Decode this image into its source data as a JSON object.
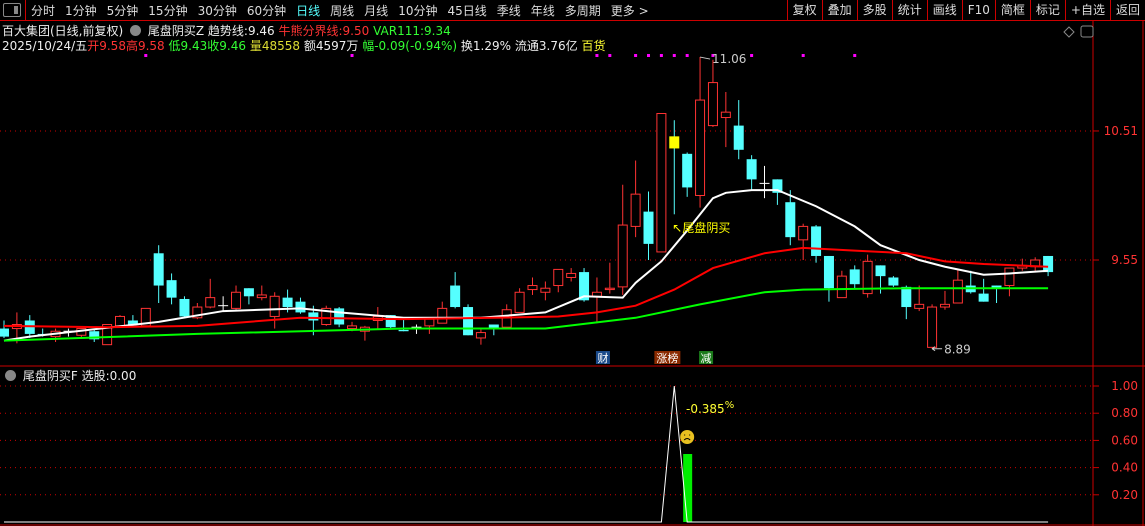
{
  "toolbar": {
    "tabs": [
      "分时",
      "1分钟",
      "5分钟",
      "15分钟",
      "30分钟",
      "60分钟",
      "日线",
      "周线",
      "月线",
      "10分钟",
      "45日线",
      "季线",
      "年线",
      "多周期",
      "更多 >"
    ],
    "active": "日线",
    "right_buttons": [
      "复权",
      "叠加",
      "多股",
      "统计",
      "画线",
      "F10",
      "简框",
      "标记",
      "+自选",
      "返回"
    ]
  },
  "header": {
    "title": "百大集团(日线,前复权)",
    "indicator": "尾盘阴买Z",
    "trend_label": "趋势线:",
    "trend_value": "9.46",
    "bull_label": "牛熊分界线:",
    "bull_value": "9.50",
    "var_label": "VAR111:",
    "var_value": "9.34"
  },
  "quote": {
    "date": "2025/10/24/五",
    "open_label": "开",
    "open": "9.58",
    "high_label": "高",
    "high": "9.58",
    "low_label": "低",
    "low": "9.43",
    "close_label": "收",
    "close": "9.46",
    "vol_label": "量",
    "vol": "48558",
    "amount": "额4597万",
    "change": "幅-0.09(-0.94%)",
    "turnover": "换1.29%",
    "float": "流通3.76亿",
    "sector": "百货"
  },
  "sub": {
    "indicator": "尾盘阴买F",
    "pick_label": "选股:",
    "pick_value": "0.00",
    "annotation": "-0.385",
    "annotation_unit": "%"
  },
  "colors": {
    "up": "#ff3333",
    "down": "#55ffff",
    "trend": "#ffffff",
    "bull_bear": "#ff0000",
    "var111": "#00ff00",
    "signal": "#ffff00",
    "dots": "#ff00ff",
    "axis": "#cc0000"
  },
  "chart_data": [
    {
      "type": "candlestick",
      "ylim": [
        8.78,
        11.17
      ],
      "y_ticks": [
        "10.51",
        "9.55"
      ],
      "y_tick_values": [
        10.51,
        9.55
      ],
      "candles_ohlc": [
        [
          9.04,
          9.1,
          8.97,
          8.98
        ],
        [
          9.04,
          9.16,
          8.93,
          9.07
        ],
        [
          9.1,
          9.14,
          8.97,
          9.0
        ],
        [
          9.0,
          9.04,
          8.98,
          8.99
        ],
        [
          8.98,
          9.04,
          8.94,
          9.02
        ],
        [
          9.02,
          9.04,
          8.98,
          9.02
        ],
        [
          8.99,
          9.04,
          8.97,
          9.04
        ],
        [
          9.02,
          9.04,
          8.94,
          8.96
        ],
        [
          8.92,
          9.07,
          8.92,
          9.07
        ],
        [
          9.06,
          9.14,
          9.05,
          9.13
        ],
        [
          9.1,
          9.14,
          9.06,
          9.07
        ],
        [
          9.06,
          9.19,
          9.06,
          9.19
        ],
        [
          9.6,
          9.66,
          9.23,
          9.36
        ],
        [
          9.4,
          9.45,
          9.22,
          9.27
        ],
        [
          9.26,
          9.28,
          9.12,
          9.13
        ],
        [
          9.12,
          9.23,
          9.11,
          9.2
        ],
        [
          9.2,
          9.41,
          9.19,
          9.27
        ],
        [
          9.21,
          9.28,
          9.17,
          9.21
        ],
        [
          9.19,
          9.36,
          9.18,
          9.31
        ],
        [
          9.34,
          9.34,
          9.22,
          9.28
        ],
        [
          9.27,
          9.36,
          9.25,
          9.29
        ],
        [
          9.13,
          9.31,
          9.04,
          9.28
        ],
        [
          9.27,
          9.33,
          9.16,
          9.2
        ],
        [
          9.24,
          9.27,
          9.15,
          9.16
        ],
        [
          9.16,
          9.21,
          8.99,
          9.1
        ],
        [
          9.07,
          9.21,
          9.06,
          9.19
        ],
        [
          9.19,
          9.2,
          9.05,
          9.07
        ],
        [
          9.04,
          9.09,
          9.02,
          9.06
        ],
        [
          9.02,
          9.06,
          8.95,
          9.05
        ],
        [
          9.1,
          9.2,
          9.04,
          9.13
        ],
        [
          9.14,
          9.14,
          9.04,
          9.05
        ],
        [
          9.03,
          9.11,
          9.02,
          9.02
        ],
        [
          9.05,
          9.07,
          9.0,
          9.05
        ],
        [
          9.06,
          9.11,
          9.0,
          9.11
        ],
        [
          9.08,
          9.24,
          9.08,
          9.19
        ],
        [
          9.36,
          9.46,
          9.19,
          9.2
        ],
        [
          9.2,
          9.22,
          8.99,
          8.99
        ],
        [
          8.97,
          9.04,
          8.92,
          9.01
        ],
        [
          9.07,
          9.07,
          8.99,
          9.04
        ],
        [
          9.05,
          9.22,
          9.05,
          9.18
        ],
        [
          9.16,
          9.34,
          9.16,
          9.31
        ],
        [
          9.33,
          9.42,
          9.29,
          9.36
        ],
        [
          9.31,
          9.39,
          9.25,
          9.34
        ],
        [
          9.36,
          9.48,
          9.31,
          9.48
        ],
        [
          9.42,
          9.49,
          9.39,
          9.45
        ],
        [
          9.46,
          9.49,
          9.24,
          9.25
        ],
        [
          9.28,
          9.42,
          9.08,
          9.31
        ],
        [
          9.33,
          9.53,
          9.3,
          9.34
        ],
        [
          9.35,
          10.11,
          9.29,
          9.81
        ],
        [
          9.8,
          10.29,
          9.72,
          10.04
        ],
        [
          9.91,
          10.06,
          9.55,
          9.67
        ],
        [
          9.61,
          10.64,
          9.61,
          10.64
        ],
        [
          10.47,
          10.59,
          9.89,
          10.38
        ],
        [
          10.34,
          10.35,
          10.02,
          10.09
        ],
        [
          10.03,
          11.06,
          9.94,
          10.74
        ],
        [
          10.55,
          11.04,
          10.54,
          10.87
        ],
        [
          10.61,
          10.8,
          10.39,
          10.65
        ],
        [
          10.55,
          10.74,
          10.3,
          10.37
        ],
        [
          10.3,
          10.33,
          10.07,
          10.15
        ],
        [
          10.12,
          10.25,
          10.01,
          10.12
        ],
        [
          10.15,
          10.15,
          9.96,
          10.05
        ],
        [
          9.98,
          10.07,
          9.66,
          9.72
        ],
        [
          9.7,
          9.82,
          9.55,
          9.8
        ],
        [
          9.8,
          9.81,
          9.53,
          9.58
        ],
        [
          9.58,
          9.58,
          9.24,
          9.34
        ],
        [
          9.27,
          9.47,
          9.27,
          9.43
        ],
        [
          9.48,
          9.51,
          9.34,
          9.37
        ],
        [
          9.3,
          9.59,
          9.27,
          9.54
        ],
        [
          9.51,
          9.51,
          9.3,
          9.43
        ],
        [
          9.42,
          9.43,
          9.35,
          9.36
        ],
        [
          9.35,
          9.36,
          9.11,
          9.2
        ],
        [
          9.19,
          9.36,
          9.17,
          9.22
        ],
        [
          8.9,
          9.22,
          8.89,
          9.2
        ],
        [
          9.2,
          9.32,
          9.18,
          9.22
        ],
        [
          9.23,
          9.48,
          9.23,
          9.4
        ],
        [
          9.36,
          9.47,
          9.3,
          9.31
        ],
        [
          9.3,
          9.41,
          9.24,
          9.24
        ],
        [
          9.36,
          9.36,
          9.23,
          9.34
        ],
        [
          9.36,
          9.49,
          9.28,
          9.49
        ],
        [
          9.49,
          9.56,
          9.47,
          9.51
        ],
        [
          9.5,
          9.57,
          9.47,
          9.55
        ],
        [
          9.58,
          9.58,
          9.43,
          9.46
        ]
      ],
      "signal_candle": 52,
      "lines": [
        {
          "name": "趋势线",
          "points": [
            [
              0,
              8.95
            ],
            [
              2,
              8.98
            ],
            [
              12,
              9.09
            ],
            [
              17,
              9.17
            ],
            [
              23,
              9.19
            ],
            [
              26,
              9.16
            ],
            [
              31,
              9.12
            ],
            [
              37,
              9.12
            ],
            [
              42,
              9.16
            ],
            [
              45,
              9.28
            ],
            [
              48,
              9.27
            ],
            [
              49,
              9.38
            ],
            [
              51,
              9.54
            ],
            [
              53,
              9.77
            ],
            [
              55,
              10.01
            ],
            [
              56,
              10.05
            ],
            [
              58,
              10.07
            ],
            [
              60,
              10.07
            ],
            [
              61,
              10.03
            ],
            [
              63,
              9.95
            ],
            [
              66,
              9.8
            ],
            [
              68,
              9.66
            ],
            [
              71,
              9.55
            ],
            [
              73,
              9.5
            ],
            [
              76,
              9.44
            ],
            [
              78,
              9.45
            ],
            [
              81,
              9.47
            ]
          ]
        },
        {
          "name": "牛熊分界线",
          "points": [
            [
              0,
              9.06
            ],
            [
              8,
              9.05
            ],
            [
              15,
              9.06
            ],
            [
              23,
              9.12
            ],
            [
              31,
              9.11
            ],
            [
              38,
              9.12
            ],
            [
              43,
              9.13
            ],
            [
              46,
              9.16
            ],
            [
              49,
              9.21
            ],
            [
              52,
              9.33
            ],
            [
              55,
              9.49
            ],
            [
              59,
              9.6
            ],
            [
              62,
              9.64
            ],
            [
              66,
              9.62
            ],
            [
              70,
              9.6
            ],
            [
              73,
              9.54
            ],
            [
              76,
              9.52
            ],
            [
              81,
              9.5
            ]
          ]
        },
        {
          "name": "VAR111",
          "points": [
            [
              0,
              8.95
            ],
            [
              15,
              9.0
            ],
            [
              31,
              9.04
            ],
            [
              42,
              9.04
            ],
            [
              49,
              9.12
            ],
            [
              54,
              9.22
            ],
            [
              59,
              9.31
            ],
            [
              62,
              9.33
            ],
            [
              70,
              9.34
            ],
            [
              81,
              9.34
            ]
          ]
        }
      ],
      "dot_signals": [
        11,
        27,
        46,
        47,
        49,
        50,
        51,
        52,
        53,
        55,
        58,
        62,
        66
      ],
      "annotations": {
        "high_label": "11.06",
        "high_index": 54,
        "low_label": "8.89",
        "low_index": 72,
        "signal_text": "尾盘阴买",
        "signal_index": 52
      },
      "badges": [
        {
          "text": "财",
          "index": 46,
          "color": "#1a4a8a"
        },
        {
          "text": "涨榜",
          "index": 51,
          "color": "#8a2a00"
        },
        {
          "text": "减",
          "index": 54,
          "color": "#1a7a1a"
        }
      ]
    },
    {
      "type": "line+bar",
      "ylim": [
        0,
        1.05
      ],
      "y_ticks": [
        "1.00",
        "0.80",
        "0.60",
        "0.40",
        "0.20"
      ],
      "y_tick_values": [
        1.0,
        0.8,
        0.6,
        0.4,
        0.2
      ],
      "line_points": [
        [
          0,
          0
        ],
        [
          51,
          0
        ],
        [
          52,
          1.0
        ],
        [
          53,
          0
        ],
        [
          81,
          0
        ]
      ],
      "bars": [
        {
          "index": 53,
          "value": 0.5
        }
      ]
    }
  ]
}
